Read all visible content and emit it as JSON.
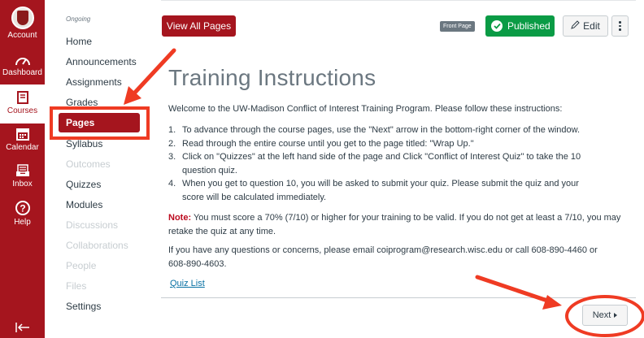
{
  "global_nav": {
    "items": [
      {
        "label": "Account",
        "icon": "avatar"
      },
      {
        "label": "Dashboard",
        "icon": "dashboard-icon"
      },
      {
        "label": "Courses",
        "icon": "courses-icon"
      },
      {
        "label": "Calendar",
        "icon": "calendar-icon"
      },
      {
        "label": "Inbox",
        "icon": "inbox-icon"
      },
      {
        "label": "Help",
        "icon": "help-icon"
      }
    ],
    "active": "Courses",
    "collapse_icon": "collapse-icon"
  },
  "course_nav": {
    "section_label": "Ongoing",
    "items": [
      {
        "label": "Home",
        "enabled": true
      },
      {
        "label": "Announcements",
        "enabled": true
      },
      {
        "label": "Assignments",
        "enabled": true
      },
      {
        "label": "Grades",
        "enabled": true
      },
      {
        "label": "Pages",
        "enabled": true,
        "active": true
      },
      {
        "label": "Syllabus",
        "enabled": true
      },
      {
        "label": "Outcomes",
        "enabled": false
      },
      {
        "label": "Quizzes",
        "enabled": true
      },
      {
        "label": "Modules",
        "enabled": true
      },
      {
        "label": "Discussions",
        "enabled": false
      },
      {
        "label": "Collaborations",
        "enabled": false
      },
      {
        "label": "People",
        "enabled": false
      },
      {
        "label": "Files",
        "enabled": false
      },
      {
        "label": "Settings",
        "enabled": true
      }
    ]
  },
  "toolbar": {
    "view_all_label": "View All Pages",
    "front_page_badge": "Front Page",
    "published_label": "Published",
    "edit_label": "Edit"
  },
  "page": {
    "title": "Training Instructions",
    "intro": "Welcome to the UW-Madison Conflict of Interest Training Program. Please follow these instructions:",
    "steps": [
      "To advance through the course pages, use the \"Next\" arrow in the bottom-right corner of the window.",
      "Read through the entire course until you get to the page titled: \"Wrap Up.\"",
      "Click on \"Quizzes\" at the left hand side of the page and Click \"Conflict of Interest Quiz\" to take the 10 question quiz.",
      "When you get to question 10, you will be asked to submit your quiz. Please submit the quiz and your score will be calculated immediately."
    ],
    "note_label": "Note:",
    "note_text": " You must score a 70% (7/10) or higher for your training to be valid. If you do not get at least a 7/10, you may retake the quiz at any time.",
    "contact": "If you have any questions or concerns, please email coiprogram@research.wisc.edu or call 608-890-4460 or 608-890-4603.",
    "quiz_link": "Quiz List"
  },
  "footer": {
    "next_label": "Next"
  },
  "colors": {
    "brand": "#a5151e",
    "published": "#0a9b45",
    "annotation": "#ef3b23",
    "link": "#0770a3"
  }
}
